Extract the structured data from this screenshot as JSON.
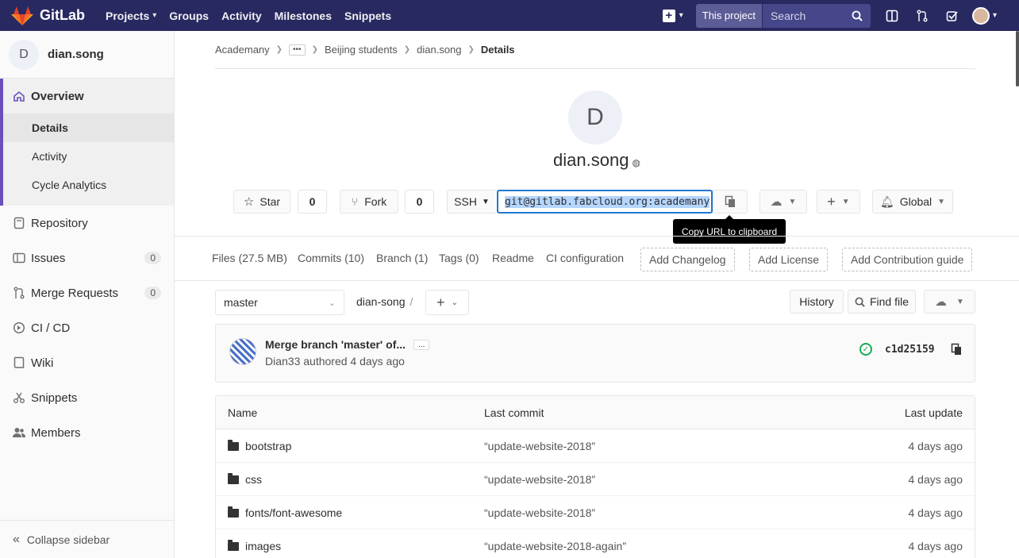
{
  "topnav": {
    "brand": "GitLab",
    "items": [
      {
        "label": "Projects",
        "dropdown": true
      },
      {
        "label": "Groups"
      },
      {
        "label": "Activity"
      },
      {
        "label": "Milestones"
      },
      {
        "label": "Snippets"
      }
    ],
    "search_scope": "This project",
    "search_placeholder": "Search"
  },
  "sidebar": {
    "project_initial": "D",
    "project_name": "dian.song",
    "overview": "Overview",
    "overview_sub": [
      "Details",
      "Activity",
      "Cycle Analytics"
    ],
    "items": [
      {
        "label": "Repository"
      },
      {
        "label": "Issues",
        "count": "0"
      },
      {
        "label": "Merge Requests",
        "count": "0"
      },
      {
        "label": "CI / CD"
      },
      {
        "label": "Wiki"
      },
      {
        "label": "Snippets"
      },
      {
        "label": "Members"
      }
    ],
    "collapse": "Collapse sidebar"
  },
  "breadcrumbs": [
    "Academany",
    "Beijing students",
    "dian.song",
    "Details"
  ],
  "project": {
    "initial": "D",
    "title": "dian.song"
  },
  "actions": {
    "star": "Star",
    "star_count": "0",
    "fork": "Fork",
    "fork_count": "0",
    "protocol": "SSH",
    "clone_url": "git@gitlab.fabcloud.org:academany",
    "notification": "Global",
    "tooltip": "Copy URL to clipboard"
  },
  "stats": {
    "files": "Files (27.5 MB)",
    "commits": "Commits (10)",
    "branch": "Branch (1)",
    "tags": "Tags (0)",
    "readme": "Readme",
    "ci": "CI configuration",
    "add_changelog": "Add Changelog",
    "add_license": "Add License",
    "add_contrib": "Add Contribution guide"
  },
  "tree": {
    "branch": "master",
    "path": "dian-song",
    "path_sep": "/",
    "history": "History",
    "find_file": "Find file"
  },
  "commit": {
    "message": "Merge branch 'master' of...",
    "more": "...",
    "author": "Dian33 authored 4 days ago",
    "sha": "c1d25159"
  },
  "files": {
    "headers": {
      "name": "Name",
      "last_commit": "Last commit",
      "last_update": "Last update"
    },
    "rows": [
      {
        "name": "bootstrap",
        "commit": "“update-website-2018”",
        "update": "4 days ago"
      },
      {
        "name": "css",
        "commit": "“update-website-2018”",
        "update": "4 days ago"
      },
      {
        "name": "fonts/font-awesome",
        "commit": "“update-website-2018”",
        "update": "4 days ago"
      },
      {
        "name": "images",
        "commit": "“update-website-2018-again”",
        "update": "4 days ago"
      }
    ]
  },
  "colors": {
    "nav": "#292961",
    "accent": "#6b4fbb",
    "link": "#1f78d1",
    "success": "#1aaa55"
  }
}
